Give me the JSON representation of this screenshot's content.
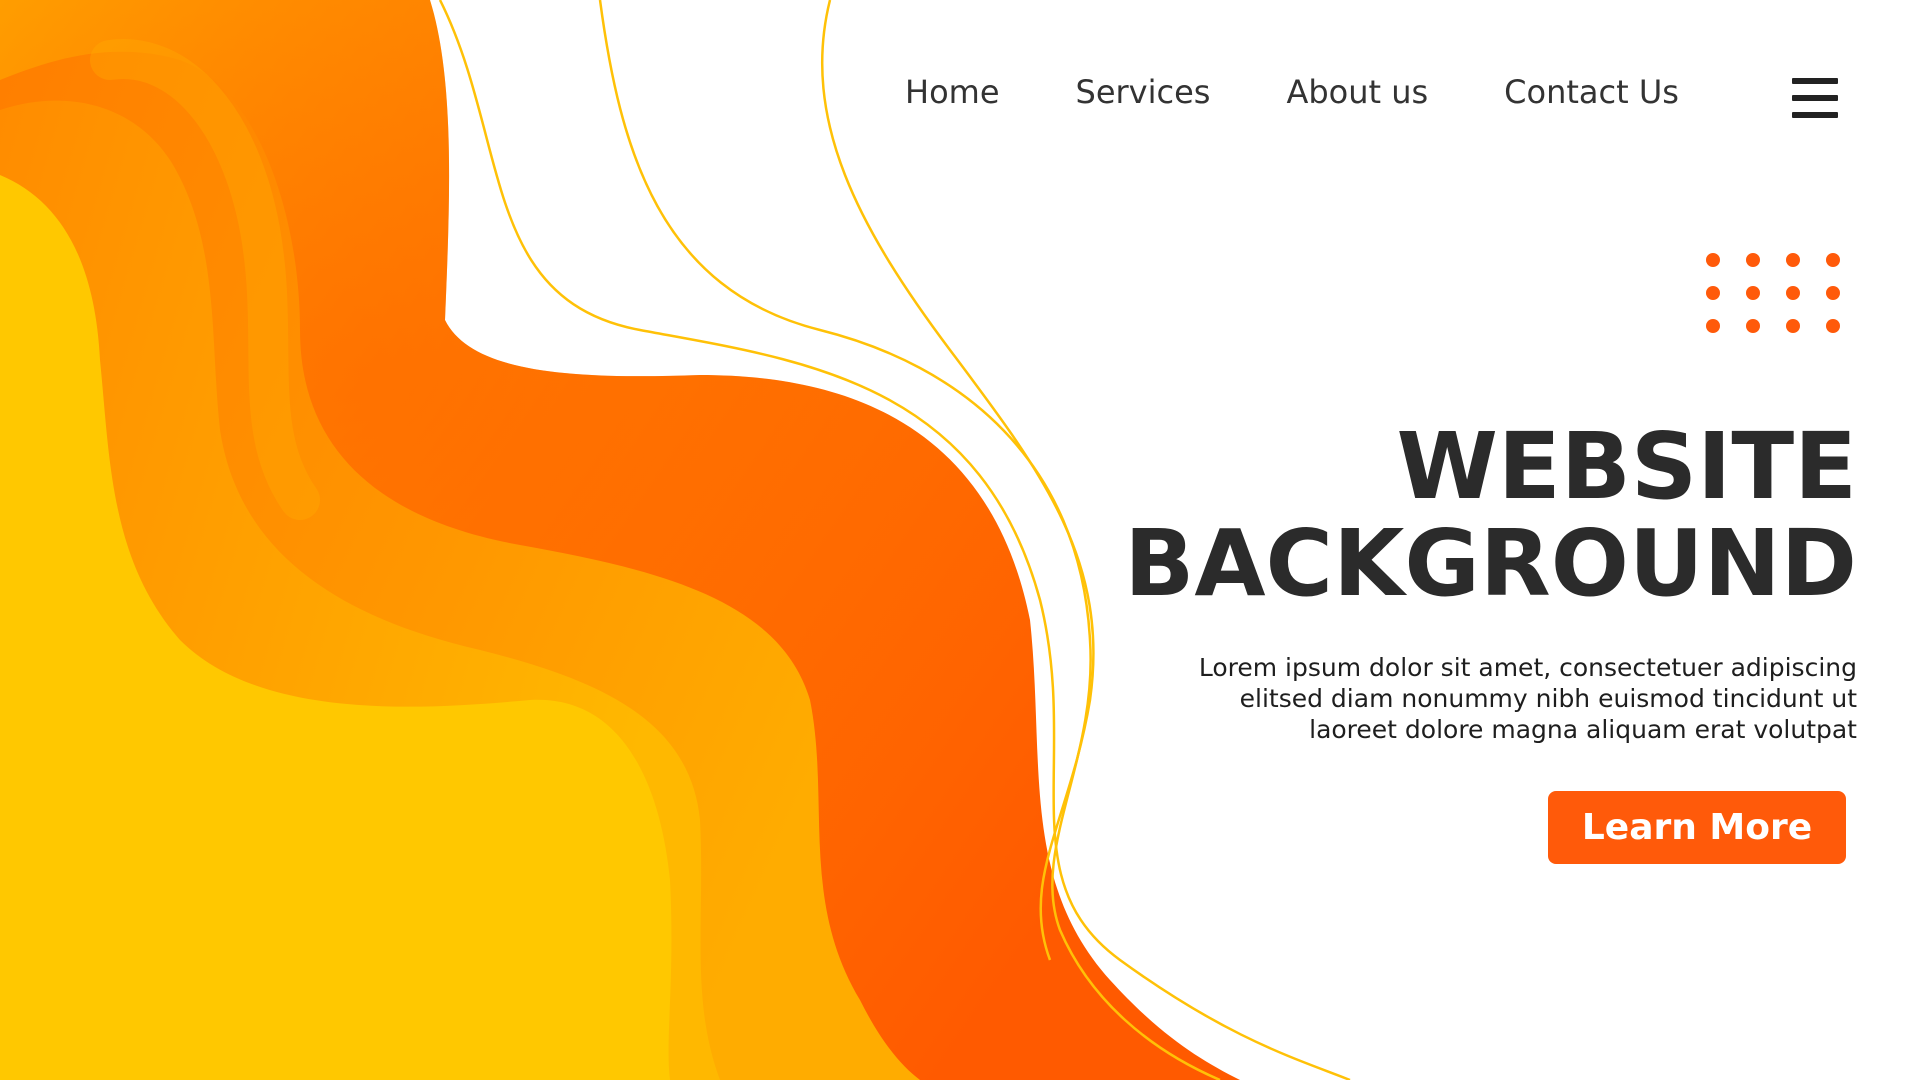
{
  "nav": {
    "items": [
      {
        "label": "Home"
      },
      {
        "label": "Services"
      },
      {
        "label": "About us"
      },
      {
        "label": "Contact Us"
      }
    ],
    "menu_icon": "hamburger-menu-icon"
  },
  "hero": {
    "title_line1": "WEBSITE",
    "title_line2": "BACKGROUND",
    "body_line1": "Lorem ipsum dolor sit amet, consectetuer adipiscing",
    "body_line2": "elitsed diam nonummy nibh euismod tincidunt ut",
    "body_line3": "laoreet dolore magna aliquam erat volutpat",
    "cta_label": "Learn More"
  },
  "colors": {
    "accent": "#ff5a0a",
    "orange_deep": "#ff6a00",
    "orange_mid": "#ff9800",
    "yellow": "#ffc800",
    "line_yellow": "#ffc107",
    "text_dark": "#2b2b2b"
  }
}
